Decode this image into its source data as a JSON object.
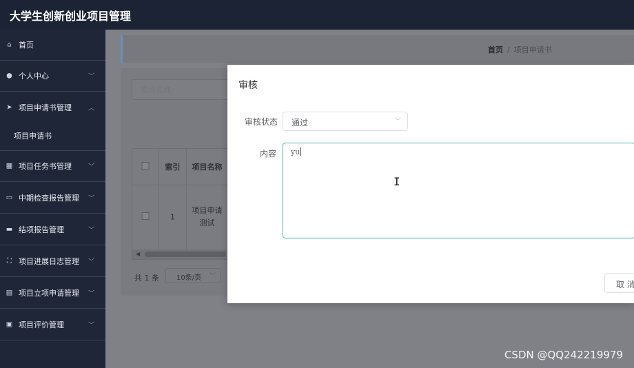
{
  "app": {
    "title": "大学生创新创业项目管理"
  },
  "sidebar": {
    "items": [
      {
        "label": "首页",
        "icon": "home-icon"
      },
      {
        "label": "个人中心",
        "icon": "user-icon"
      },
      {
        "label": "项目申请书管理",
        "icon": "send-icon"
      },
      {
        "label": "项目任务书管理",
        "icon": "grid-icon"
      },
      {
        "label": "中期检查报告管理",
        "icon": "message-icon"
      },
      {
        "label": "结项报告管理",
        "icon": "chat-icon"
      },
      {
        "label": "项目进展日志管理",
        "icon": "fullscreen-icon"
      },
      {
        "label": "项目立项申请管理",
        "icon": "chart-icon"
      },
      {
        "label": "项目评价管理",
        "icon": "clipboard-icon"
      }
    ],
    "sub_item": "项目申请书"
  },
  "breadcrumb": {
    "home": "首页",
    "separator": "/",
    "current": "项目申请书"
  },
  "search": {
    "placeholder": "项目名称"
  },
  "table": {
    "headers": [
      "",
      "索引",
      "项目名称"
    ],
    "rows": [
      {
        "index": "1",
        "name_line1": "项目申请",
        "name_line2": "测试"
      }
    ]
  },
  "pager": {
    "total": "共 1 条",
    "page_size": "10条/页"
  },
  "dialog": {
    "title": "审核",
    "status_label": "审核状态",
    "status_value": "通过",
    "content_label": "内容",
    "content_value": "yu",
    "cancel_label": "取 消"
  },
  "watermark": "CSDN @QQ242219979"
}
